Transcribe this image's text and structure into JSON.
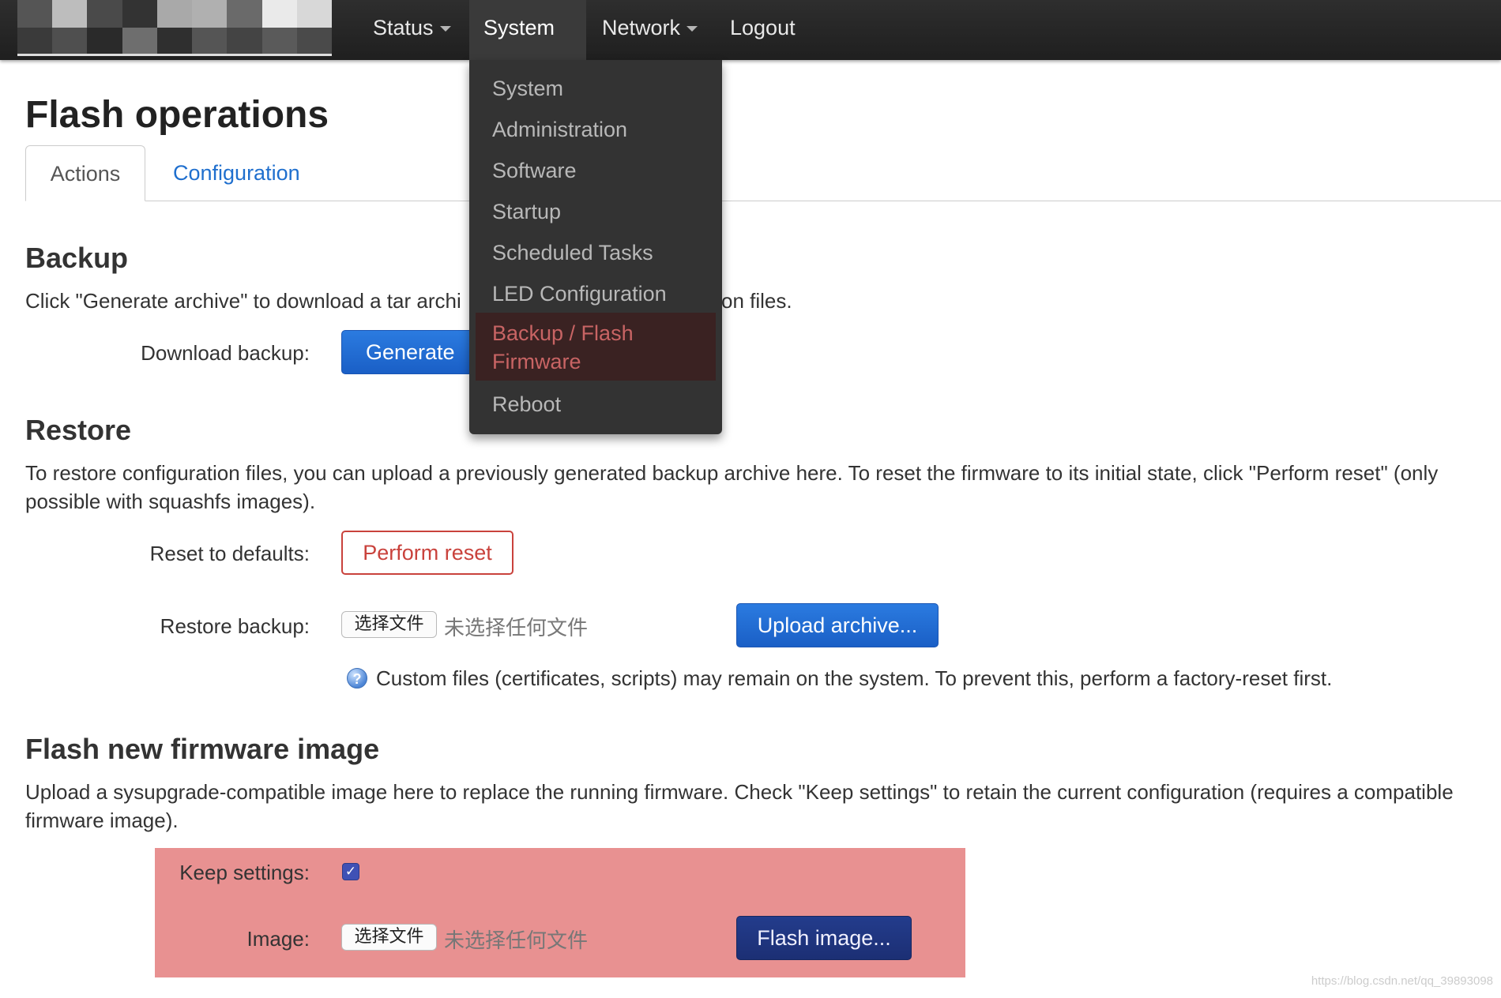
{
  "navbar": {
    "items": [
      {
        "label": "Status",
        "dropdown": true
      },
      {
        "label": "System",
        "dropdown": true,
        "active": true
      },
      {
        "label": "Network",
        "dropdown": true
      },
      {
        "label": "Logout",
        "dropdown": false
      }
    ]
  },
  "dropdown": {
    "items": [
      "System",
      "Administration",
      "Software",
      "Startup",
      "Scheduled Tasks",
      "LED Configuration",
      "Backup / Flash",
      "Firmware",
      "Reboot"
    ]
  },
  "page": {
    "title": "Flash operations",
    "tabs": [
      "Actions",
      "Configuration"
    ]
  },
  "backup": {
    "heading": "Backup",
    "desc_start": "Click \"Generate archive\" to download a tar archi",
    "desc_end": "on files.",
    "download_label": "Download backup:",
    "generate_button": "Generate ar"
  },
  "restore": {
    "heading": "Restore",
    "desc_line1": "To restore configuration files, you can upload a previously generated backup archive here. To reset the firmware to its initial state, click \"Perform reset\" (only",
    "desc_line2": "possible with squashfs images).",
    "reset_label": "Reset to defaults:",
    "reset_button": "Perform reset",
    "restore_label": "Restore backup:",
    "choose_file": "选择文件",
    "no_file": "未选择任何文件",
    "upload_button": "Upload archive...",
    "help_text": "Custom files (certificates, scripts) may remain on the system. To prevent this, perform a factory-reset first."
  },
  "flash": {
    "heading": "Flash new firmware image",
    "desc_line1": "Upload a sysupgrade-compatible image here to replace the running firmware. Check \"Keep settings\" to retain the current configuration (requires a compatible",
    "desc_line2": "firmware image).",
    "keep_label": "Keep settings:",
    "keep_checked": true,
    "check_mark": "✓",
    "image_label": "Image:",
    "choose_file": "选择文件",
    "no_file": "未选择任何文件",
    "flash_button": "Flash image..."
  },
  "watermark": "https://blog.csdn.net/qq_39893098",
  "colors": {
    "navbar": "#262626",
    "dropdown": "#333333",
    "link": "#1f6fce",
    "primary": "#1a5fc6",
    "danger": "#c9423c",
    "highlight": "#e89191"
  }
}
